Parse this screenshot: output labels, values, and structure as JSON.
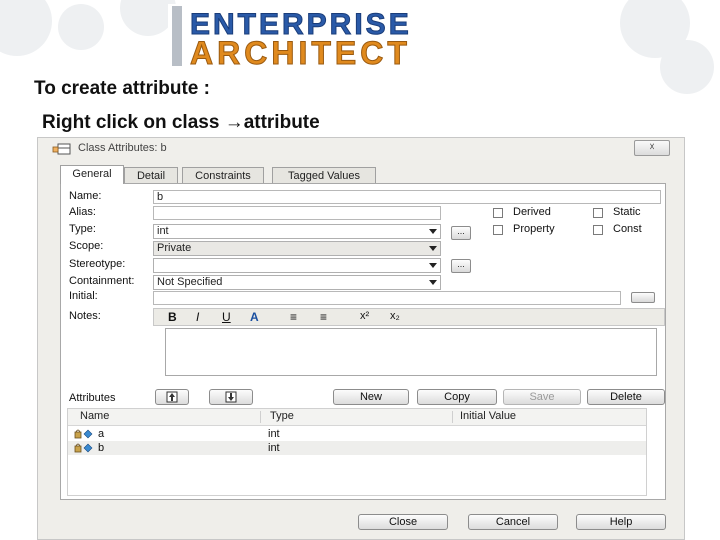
{
  "slide": {
    "logo_line1": "ENTERPRISE",
    "logo_line2": "ARCHITECT",
    "heading": "To create attribute :",
    "instruction_prefix": "Right click on class",
    "instruction_arrow": "→",
    "instruction_target": "attribute"
  },
  "dialog": {
    "title": "Class Attributes: b",
    "close_label": "☓",
    "tabs": [
      "General",
      "Detail",
      "Constraints",
      "Tagged Values"
    ],
    "active_tab": "General",
    "labels": {
      "name": "Name:",
      "alias": "Alias:",
      "type": "Type:",
      "scope": "Scope:",
      "stereotype": "Stereotype:",
      "containment": "Containment:",
      "initial": "Initial:",
      "notes": "Notes:",
      "attributes": "Attributes"
    },
    "values": {
      "name": "b",
      "alias": "",
      "type": "int",
      "scope": "Private",
      "stereotype": "",
      "containment": "Not Specified",
      "initial": ""
    },
    "type_button_label": "...",
    "stereotype_button_label": "...",
    "initial_button_label": "",
    "checkboxes": {
      "derived": {
        "label": "Derived",
        "checked": false
      },
      "static": {
        "label": "Static",
        "checked": false
      },
      "property": {
        "label": "Property",
        "checked": false
      },
      "const": {
        "label": "Const",
        "checked": false
      }
    },
    "notes_toolbar": {
      "bold": "B",
      "italic": "I",
      "underline": "U",
      "color": "A",
      "bullets": "≡",
      "numbering": "≡",
      "superscript": "x²",
      "subscript": "x₂"
    },
    "attr_buttons": {
      "new": "New",
      "copy": "Copy",
      "save": "Save",
      "delete": "Delete"
    },
    "list_columns": [
      "Name",
      "Type",
      "Initial Value"
    ],
    "list_rows": [
      {
        "name": "a",
        "type": "int",
        "initial": ""
      },
      {
        "name": "b",
        "type": "int",
        "initial": ""
      }
    ],
    "footer_buttons": {
      "close": "Close",
      "cancel": "Cancel",
      "help": "Help"
    },
    "colors": {
      "dialog_bg": "#efeeea",
      "logo_blue": "#2a5aa8",
      "logo_orange": "#e08a1e"
    }
  }
}
